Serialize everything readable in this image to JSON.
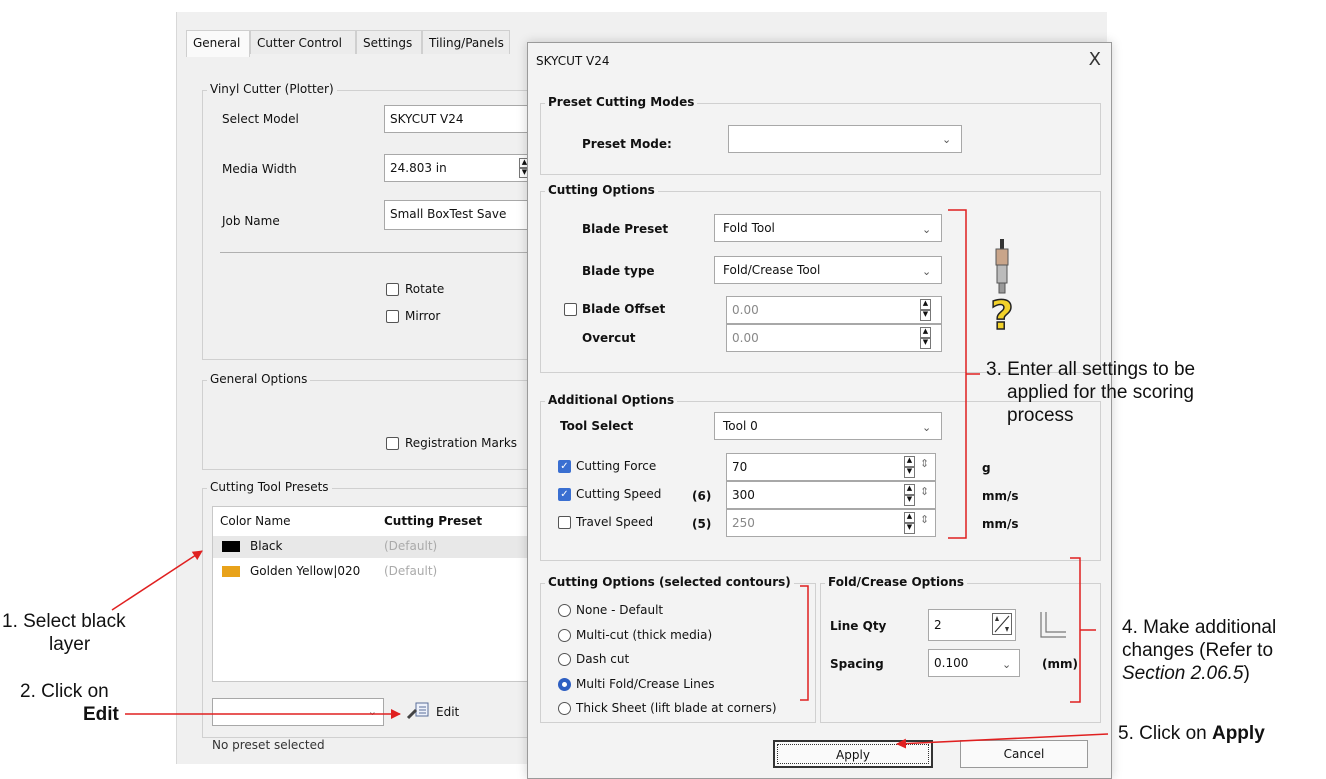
{
  "tabs": [
    "General",
    "Cutter Control",
    "Settings",
    "Tiling/Panels"
  ],
  "vinyl": {
    "title": "Vinyl Cutter (Plotter)",
    "model_label": "Select Model",
    "model_value": "SKYCUT V24",
    "width_label": "Media Width",
    "width_value": "24.803 in",
    "job_label": "Job Name",
    "job_value": "Small BoxTest Save",
    "rotate_label": "Rotate",
    "mirror_label": "Mirror"
  },
  "general_options": {
    "title": "General Options",
    "reg_label": "Registration Marks"
  },
  "presets": {
    "title": "Cutting Tool Presets",
    "col1": "Color Name",
    "col2": "Cutting Preset",
    "rows": [
      {
        "name": "Black",
        "preset": "(Default)",
        "color": "#000000"
      },
      {
        "name": "Golden Yellow|020",
        "preset": "(Default)",
        "color": "#e8a21a"
      }
    ],
    "edit_label": "Edit",
    "status": "No preset selected"
  },
  "dialog": {
    "title": "SKYCUT V24",
    "close": "X",
    "preset_modes": {
      "title": "Preset Cutting Modes",
      "label": "Preset Mode:",
      "value": ""
    },
    "cutting_options": {
      "title": "Cutting Options",
      "blade_preset_label": "Blade Preset",
      "blade_preset_value": "Fold Tool",
      "blade_type_label": "Blade type",
      "blade_type_value": "Fold/Crease Tool",
      "blade_offset_label": "Blade Offset",
      "blade_offset_value": "0.00",
      "overcut_label": "Overcut",
      "overcut_value": "0.00"
    },
    "additional": {
      "title": "Additional Options",
      "tool_label": "Tool Select",
      "tool_value": "Tool 0",
      "force_label": "Cutting Force",
      "force_value": "70",
      "force_unit": "g",
      "speed_label": "Cutting Speed",
      "speed_num": "(6)",
      "speed_value": "300",
      "speed_unit": "mm/s",
      "travel_label": "Travel Speed",
      "travel_num": "(5)",
      "travel_value": "250",
      "travel_unit": "mm/s"
    },
    "selected": {
      "title": "Cutting Options (selected contours)",
      "options": [
        "None - Default",
        "Multi-cut (thick media)",
        "Dash cut",
        "Multi Fold/Crease Lines",
        "Thick Sheet (lift blade at corners)"
      ],
      "selected_index": 3
    },
    "fold": {
      "title": "Fold/Crease Options",
      "qty_label": "Line Qty",
      "qty_value": "2",
      "spacing_label": "Spacing",
      "spacing_value": "0.100",
      "unit": "(mm)"
    },
    "apply": "Apply",
    "cancel": "Cancel"
  },
  "annotations": {
    "a1_line1": "1. Select black",
    "a1_line2": "layer",
    "a2_line1": "2. Click on",
    "a2_line2": "Edit",
    "a3_line1": "3. Enter all settings to be",
    "a3_line2": "applied for the scoring",
    "a3_line3": "process",
    "a4_line1": "4. Make additional",
    "a4_line2": "changes (Refer to",
    "a4_line3": "Section 2.06.5",
    "a4_tail": ")",
    "a5_prefix": "5. Click on ",
    "a5_bold": "Apply"
  },
  "colors": {
    "accent": "#3a6fd1",
    "annotation_red": "#e02020",
    "dialog_bg": "#f3f3f3",
    "window_bg": "#f0f0f0"
  }
}
